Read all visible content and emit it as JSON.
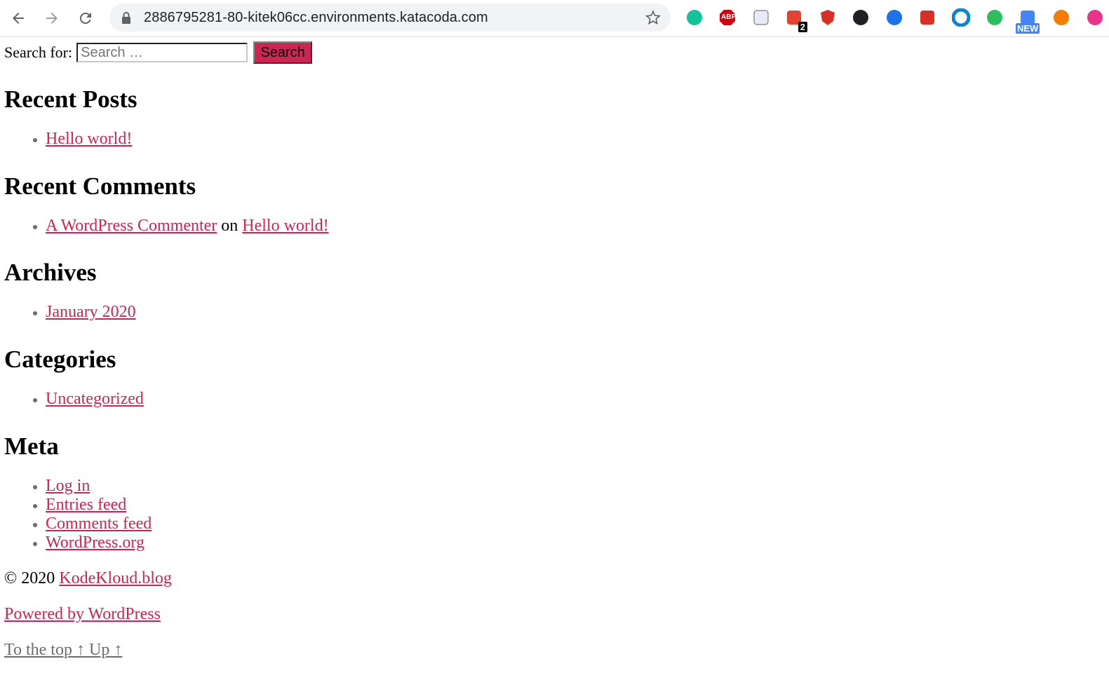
{
  "browser": {
    "url": "2886795281-80-kitek06cc.environments.katacoda.com",
    "extensions": [
      {
        "name": "grammarly-icon",
        "color": "#15c39a"
      },
      {
        "name": "adblock-plus-icon",
        "color": "#d6000b",
        "label": "ABP"
      },
      {
        "name": "search-ext-icon",
        "color": "#5f6368"
      },
      {
        "name": "todoist-icon",
        "color": "#e44332",
        "badge": "2"
      },
      {
        "name": "shield-ext-icon",
        "color": "#d93025"
      },
      {
        "name": "dark-mode-icon",
        "color": "#202124"
      },
      {
        "name": "highlighter-icon",
        "color": "#1a73e8"
      },
      {
        "name": "pdf-ext-icon",
        "color": "#d93025"
      },
      {
        "name": "circle-ext-icon",
        "color": "#0b84d4"
      },
      {
        "name": "evernote-icon",
        "color": "#2dbe60"
      },
      {
        "name": "new-ext-icon",
        "color": "#4285f4",
        "label": "NEW"
      },
      {
        "name": "hand-ext-icon",
        "color": "#f57c00"
      },
      {
        "name": "star-ext-icon",
        "color": "#e8338b"
      }
    ]
  },
  "search": {
    "label": "Search for:",
    "placeholder": "Search …",
    "button": "Search"
  },
  "sections": {
    "recent_posts": {
      "title": "Recent Posts",
      "items": [
        "Hello world!"
      ]
    },
    "recent_comments": {
      "title": "Recent Comments",
      "author": "A WordPress Commenter",
      "on": "on",
      "post": "Hello world!"
    },
    "archives": {
      "title": "Archives",
      "items": [
        "January 2020"
      ]
    },
    "categories": {
      "title": "Categories",
      "items": [
        "Uncategorized"
      ]
    },
    "meta": {
      "title": "Meta",
      "items": [
        "Log in",
        "Entries feed",
        "Comments feed",
        "WordPress.org"
      ]
    }
  },
  "footer": {
    "copyright": "© 2020",
    "site": "KodeKloud.blog",
    "powered": "Powered by WordPress",
    "to_top": "To the top ↑",
    "up": "Up ↑"
  }
}
